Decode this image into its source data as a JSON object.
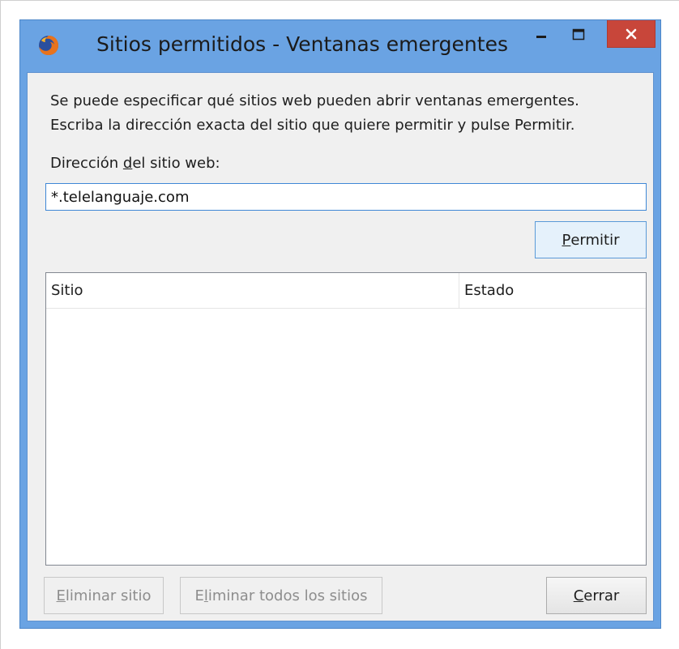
{
  "window": {
    "title": "Sitios permitidos - Ventanas emergentes",
    "icon": "firefox-icon",
    "accent_color": "#6aa3e3",
    "close_color": "#c8463a"
  },
  "description": {
    "line1": "Se puede especificar qué sitios web pueden abrir ventanas emergentes.",
    "line2": "Escriba la dirección exacta del sitio que quiere permitir y pulse Permitir."
  },
  "address": {
    "label_before": "Dirección ",
    "label_mnemonic": "d",
    "label_after": "el sitio web:",
    "value": "*.telelanguaje.com"
  },
  "allow_button": {
    "mnemonic": "P",
    "rest": "ermitir"
  },
  "table": {
    "columns": [
      "Sitio",
      "Estado"
    ],
    "rows": []
  },
  "footer": {
    "remove_site": {
      "mnemonic": "E",
      "rest": "liminar sitio"
    },
    "remove_all": {
      "before": "E",
      "mnemonic": "l",
      "rest": "iminar todos los sitios"
    },
    "close": {
      "mnemonic": "C",
      "rest": "errar"
    }
  }
}
